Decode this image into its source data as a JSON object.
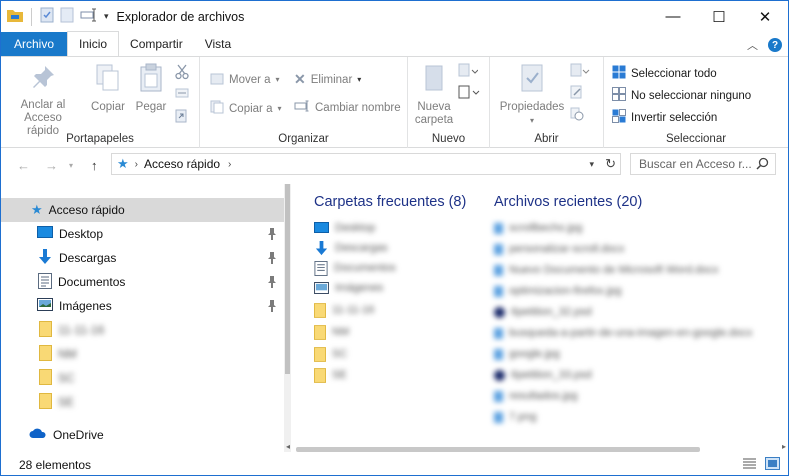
{
  "window": {
    "title": "Explorador de archivos",
    "controls": {
      "minimize": "—",
      "maximize": "☐",
      "close": "✕"
    }
  },
  "ribbon_tabs": [
    "Archivo",
    "Inicio",
    "Compartir",
    "Vista"
  ],
  "ribbon": {
    "portapapeles": {
      "label": "Portapapeles",
      "pin": "Anclar al Acceso rápido",
      "copy": "Copiar",
      "paste": "Pegar"
    },
    "organizar": {
      "label": "Organizar",
      "move_to": "Mover a",
      "copy_to": "Copiar a",
      "delete": "Eliminar",
      "rename": "Cambiar nombre"
    },
    "nuevo": {
      "label": "Nuevo",
      "new_folder": "Nueva carpeta"
    },
    "abrir": {
      "label": "Abrir",
      "properties": "Propiedades"
    },
    "seleccionar": {
      "label": "Seleccionar",
      "select_all": "Seleccionar todo",
      "select_none": "No seleccionar ninguno",
      "invert": "Invertir selección"
    }
  },
  "address": {
    "crumb": "Acceso rápido",
    "search_placeholder": "Buscar en Acceso r..."
  },
  "nav_pane": {
    "quick_access": "Acceso rápido",
    "items": [
      {
        "label": "Desktop",
        "pinned": true
      },
      {
        "label": "Descargas",
        "pinned": true
      },
      {
        "label": "Documentos",
        "pinned": true
      },
      {
        "label": "Imágenes",
        "pinned": true
      },
      {
        "label": "11-11-16",
        "pinned": false
      },
      {
        "label": "NM",
        "pinned": false
      },
      {
        "label": "SC",
        "pinned": false
      },
      {
        "label": "SE",
        "pinned": false
      }
    ],
    "onedrive": "OneDrive"
  },
  "content": {
    "frequent_title": "Carpetas frecuentes (8)",
    "recent_title": "Archivos recientes (20)",
    "frequent": [
      "Desktop",
      "Descargas",
      "Documentos",
      "Imágenes",
      "11-11-16",
      "NM",
      "SC",
      "SE"
    ],
    "recent": [
      "scrollbecho.jpg",
      "personalizar-scroll.docx",
      "Nuevo Documento de Microsoft Word.docx",
      "optimizacion-firefox.jpg",
      "6petition_32.psd",
      "busqueda-a-partir-de-una-imagen-en-google.docx",
      "google.jpg",
      "6petition_33.psd",
      "resultados.jpg",
      "7.png"
    ]
  },
  "status": {
    "count": "28 elementos"
  },
  "colors": {
    "accent": "#1979ca",
    "heading": "#1e3287"
  }
}
